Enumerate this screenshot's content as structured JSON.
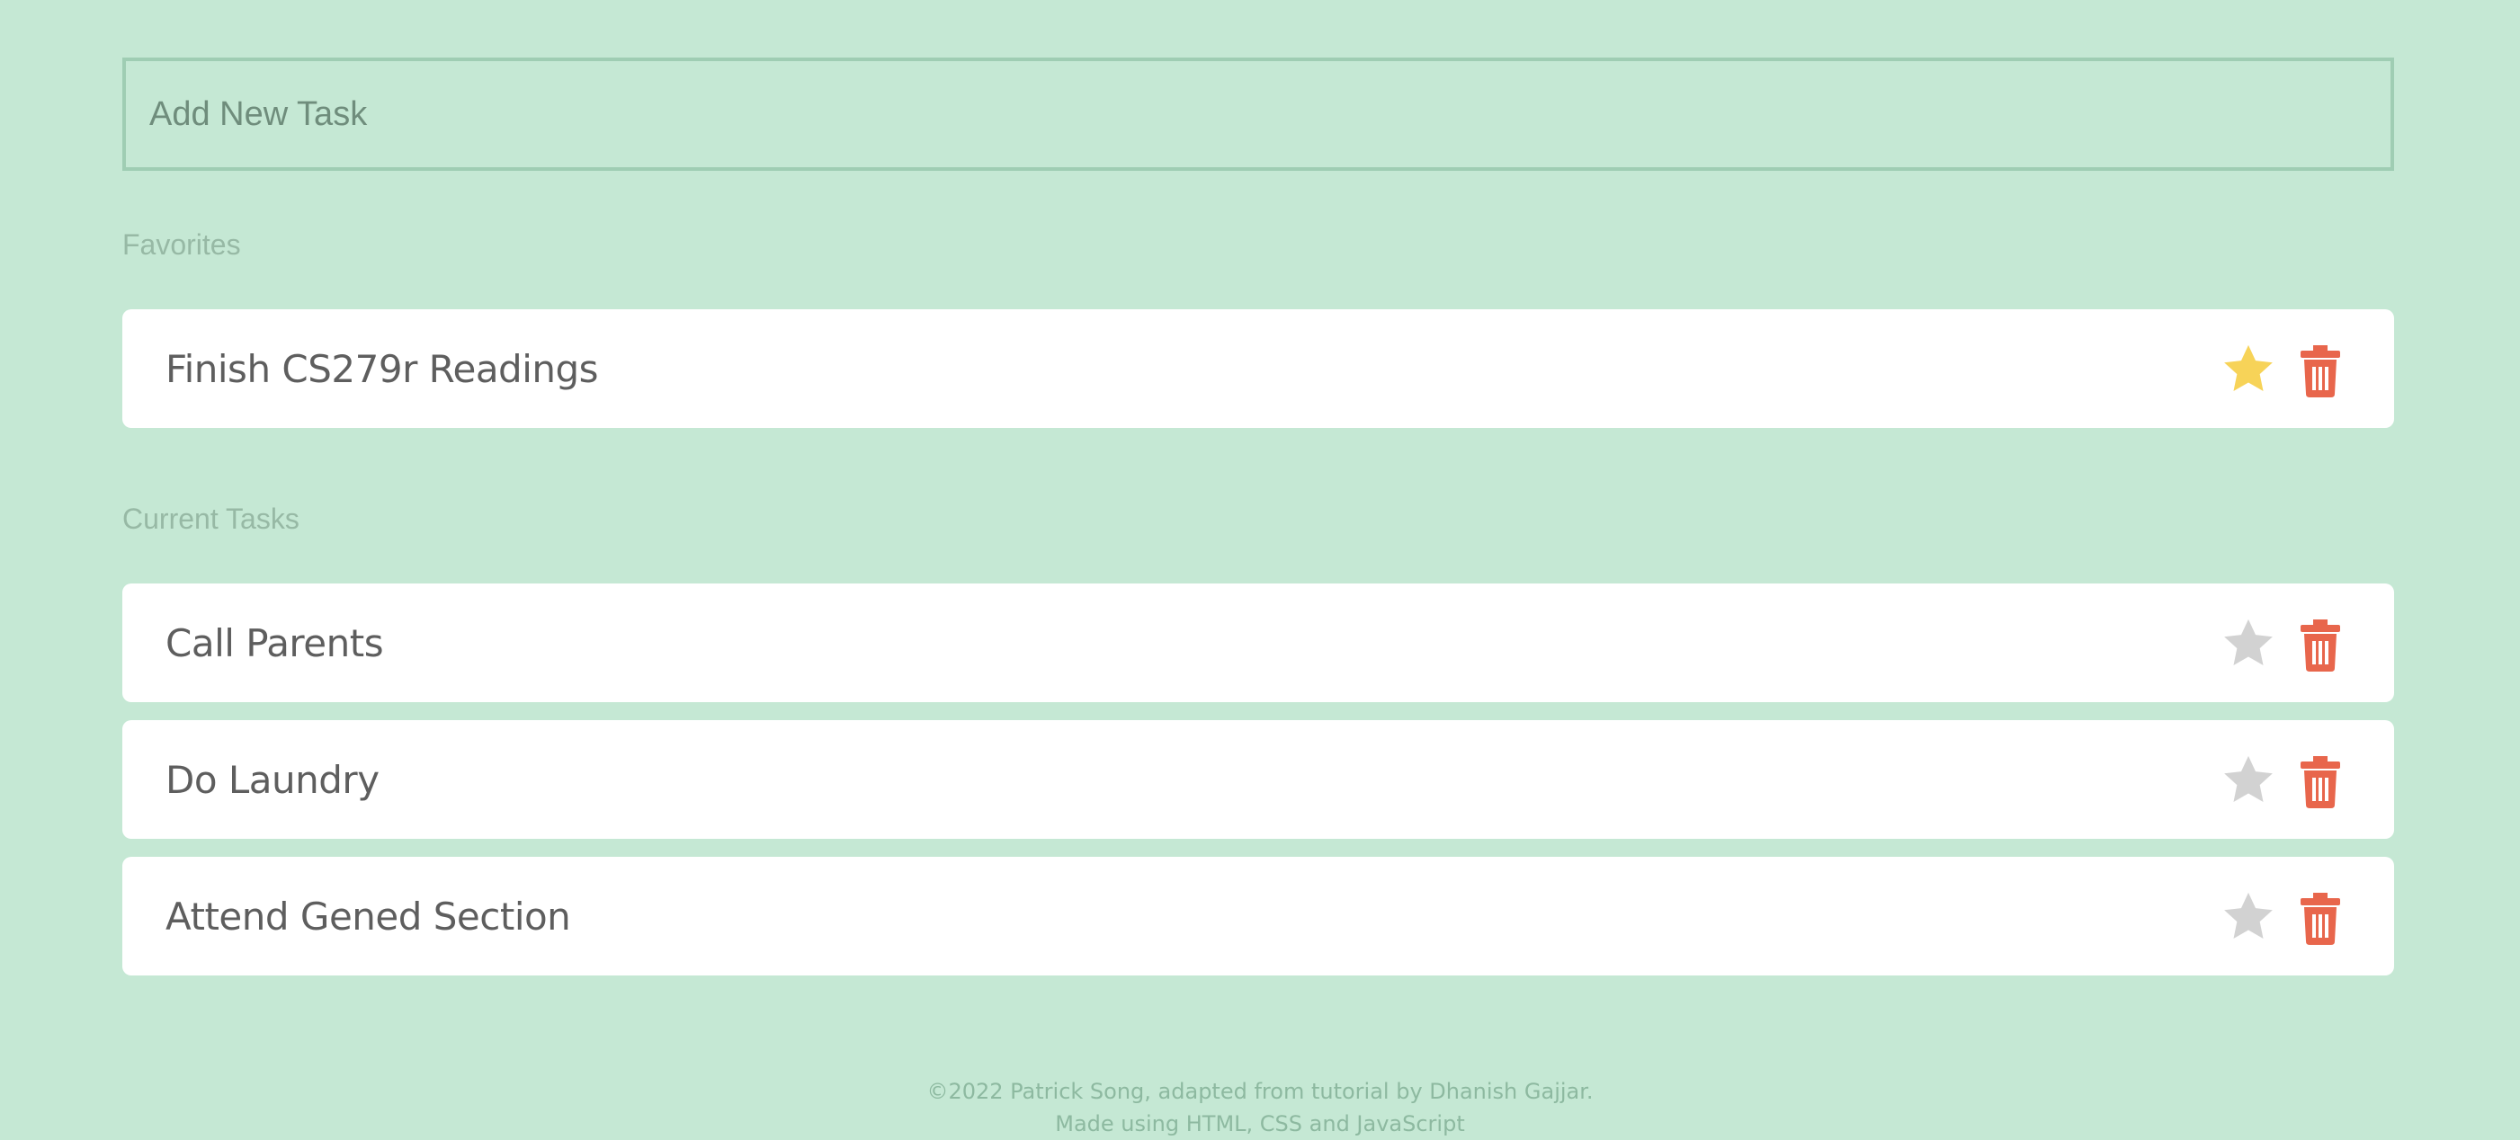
{
  "new_task": {
    "placeholder": "Add New Task"
  },
  "sections": {
    "favorites_title": "Favorites",
    "current_title": "Current Tasks"
  },
  "favorites": [
    {
      "label": "Finish CS279r Readings",
      "starred": true
    }
  ],
  "current": [
    {
      "label": "Call Parents",
      "starred": false
    },
    {
      "label": "Do Laundry",
      "starred": false
    },
    {
      "label": "Attend Gened Section",
      "starred": false
    }
  ],
  "icons": {
    "star": "star-icon",
    "trash": "trash-icon"
  },
  "colors": {
    "background": "#c5e8d4",
    "star_active": "#f7d358",
    "star_inactive": "#d2d2d2",
    "trash": "#e8664c"
  },
  "footer": {
    "line1": "©2022 Patrick Song, adapted from tutorial by Dhanish Gajjar.",
    "line2": "Made using HTML, CSS and JavaScript"
  }
}
